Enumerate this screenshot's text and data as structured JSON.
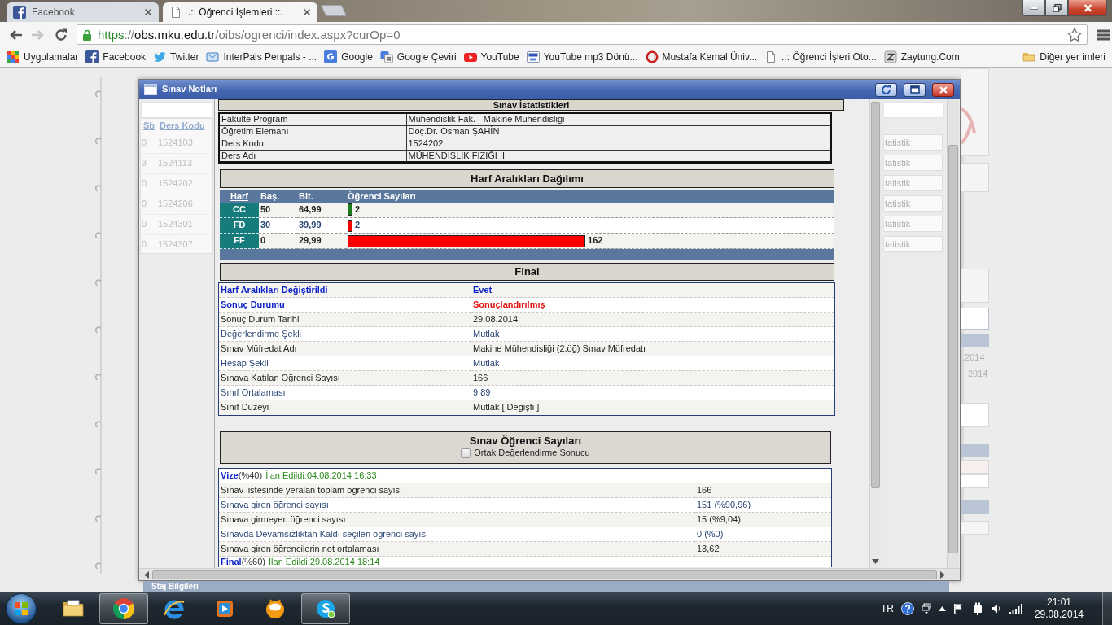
{
  "browser": {
    "tabs": [
      {
        "title": "Facebook",
        "selected": false
      },
      {
        "title": ".:: Öğrenci İşlemleri ::.",
        "selected": true
      }
    ],
    "nav_buttons": [
      {
        "disabled": false
      },
      {
        "disabled": true
      },
      {
        "disabled": false
      }
    ],
    "address": [
      {
        "text": "https",
        "kind": "scheme"
      },
      {
        "text": "://",
        "kind": "dim"
      },
      {
        "text": "obs.mku.edu.tr",
        "kind": "host"
      },
      {
        "text": "/oibs/ogrenci/index.aspx?curOp=0",
        "kind": "dim"
      }
    ],
    "bookmarks": [
      "Uygulamalar",
      "Facebook",
      "Twitter",
      "InterPals Penpals - ...",
      "Google",
      "Google Çeviri",
      "YouTube",
      "YouTube mp3 Dönü...",
      "Mustafa Kemal Üniv...",
      ".:: Öğrenci İşleri Oto...",
      "Zaytung.Com"
    ],
    "other_bookmarks": "Diğer yer imleri"
  },
  "page_behind": {
    "course_table": {
      "columns": [
        "Sb",
        "Ders Kodu"
      ],
      "rows": [
        [
          "0",
          "1524103"
        ],
        [
          "3",
          "1524113"
        ],
        [
          "0",
          "1524202"
        ],
        [
          "0",
          "1524206"
        ],
        [
          "0",
          "1524301"
        ],
        [
          "0",
          "1524307"
        ]
      ]
    },
    "statistics_buttons": [
      "tatistik",
      "tatistik",
      "tatistik",
      "tatistik",
      "tatistik",
      "tatistik"
    ],
    "date_fragments": [
      ".2014",
      "2014"
    ],
    "lower_panel_title": "Staj Bilgileri"
  },
  "dialog": {
    "title": "Sınav Notları",
    "statistics": {
      "title": "Sınav İstatistikleri",
      "rows": [
        {
          "label": "Fakülte Program",
          "value": "Mühendislik Fak. - Makine Mühendisliği"
        },
        {
          "label": "Öğretim Elemanı",
          "value": "Doç.Dr. Osman ŞAHİN"
        },
        {
          "label": "Ders Kodu",
          "value": "1524202"
        },
        {
          "label": "Ders Adı",
          "value": "MÜHENDİSLİK FİZİĞİ II"
        }
      ]
    },
    "grade_ranges": {
      "title": "Harf Aralıkları Dağılımı",
      "columns": [
        {
          "text": "Harf",
          "link": true
        },
        {
          "text": "Baş.",
          "link": false
        },
        {
          "text": "Bit.",
          "link": false
        },
        {
          "text": "Öğrenci Sayıları",
          "link": false
        }
      ],
      "rows": [
        {
          "letter": "CC",
          "start": "50",
          "end": "64,99",
          "count": "2",
          "level": 0.01,
          "color": "#1a7a1a"
        },
        {
          "letter": "FD",
          "start": "30",
          "end": "39,99",
          "count": "2",
          "level": 0.01,
          "color": "#ff0000"
        },
        {
          "letter": "FF",
          "start": "0",
          "end": "29,99",
          "count": "162",
          "level": 0.49,
          "color": "#ff0000"
        }
      ]
    },
    "final": {
      "title": "Final",
      "rows": [
        {
          "kind": "flag",
          "label": "Harf Aralıkları Değiştirildi",
          "value": "Evet"
        },
        {
          "kind": "status",
          "label": "Sonuç Durumu",
          "value": "Sonuçlandırılmış"
        },
        {
          "kind": "plain",
          "label": "Sonuç Durum Tarihi",
          "value": "29.08.2014"
        },
        {
          "kind": "plain",
          "label": "Değerlendirme Şekli",
          "value": "Mutlak"
        },
        {
          "kind": "plain",
          "label": "Sınav Müfredat Adı",
          "value": "Makine Mühendisliği (2.öğ) Sınav Müfredatı"
        },
        {
          "kind": "plain",
          "label": "Hesap Şekli",
          "value": "Mutlak"
        },
        {
          "kind": "plain",
          "label": "Sınava Katılan Öğrenci Sayısı",
          "value": "166"
        },
        {
          "kind": "plain",
          "label": "Sınıf Ortalaması",
          "value": "9,89"
        },
        {
          "kind": "plain",
          "label": "Sınıf Düzeyi",
          "value": "Mutlak [ Değişti ]"
        }
      ]
    },
    "exam_counts": {
      "title": "Sınav Öğrenci Sayıları",
      "joint_result": {
        "label": "Ortak Değerlendirme Sonucu",
        "checked": false
      },
      "exams": [
        {
          "name": "Vize",
          "weight": "(%40)",
          "announced": "İlan Edildi:04.08.2014 16:33",
          "rows": [
            {
              "label": "Sınav listesinde yeralan toplam öğrenci sayısı",
              "value": "166"
            },
            {
              "label": "Sınava giren öğrenci sayısı",
              "value": "151 (%90,96)"
            },
            {
              "label": "Sınava girmeyen öğrenci sayısı",
              "value": "15 (%9,04)"
            },
            {
              "label": "Sınavda Devamsızlıktan Kaldı seçilen öğrenci sayısı",
              "value": "0 (%0)"
            },
            {
              "label": "Sınava giren öğrencilerin not ortalaması",
              "value": "13,62"
            }
          ]
        },
        {
          "name": "Final",
          "weight": "(%60)",
          "announced": "İlan Edildi:29.08.2014 18:14"
        }
      ]
    }
  },
  "taskbar": {
    "apps": [
      {
        "running": false
      },
      {
        "running": true
      },
      {
        "running": false
      },
      {
        "running": false
      },
      {
        "running": false
      },
      {
        "running": true
      }
    ],
    "language": "TR",
    "time": "21:01",
    "date": "29.08.2014"
  }
}
